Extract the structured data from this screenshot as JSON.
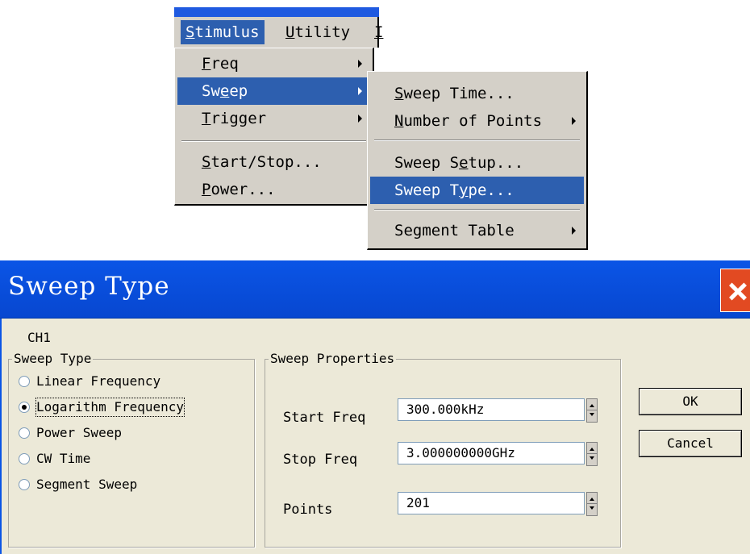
{
  "menubar": {
    "items": [
      {
        "label": "Stimulus",
        "mnemonic_first": "S",
        "rest": "timulus",
        "selected": true
      },
      {
        "label": "Utility",
        "mnemonic_first": "U",
        "rest": "tility",
        "selected": false
      },
      {
        "label": "I",
        "mnemonic_first": "I",
        "rest": "",
        "selected": false
      }
    ]
  },
  "stimulus_menu": {
    "items": [
      {
        "pre": "",
        "mn": "F",
        "post": "req",
        "submenu": true
      },
      {
        "pre": "Sw",
        "mn": "e",
        "post": "ep",
        "submenu": true,
        "selected": true
      },
      {
        "pre": "",
        "mn": "T",
        "post": "rigger",
        "submenu": true
      },
      {
        "pre": "",
        "mn": "S",
        "post": "tart/Stop...",
        "submenu": false
      },
      {
        "pre": "",
        "mn": "P",
        "post": "ower...",
        "submenu": false
      }
    ]
  },
  "sweep_menu": {
    "items": [
      {
        "pre": "",
        "mn": "S",
        "post": "weep Time...",
        "submenu": false
      },
      {
        "pre": "",
        "mn": "N",
        "post": "umber of Points",
        "submenu": true
      },
      {
        "pre": "Sweep S",
        "mn": "e",
        "post": "tup...",
        "submenu": false
      },
      {
        "pre": "Sweep T",
        "mn": "y",
        "post": "pe...",
        "submenu": false,
        "selected": true
      },
      {
        "pre": "Segment Table",
        "mn": "",
        "post": "",
        "submenu": true
      }
    ]
  },
  "dialog": {
    "title": "Sweep Type",
    "channel": "CH1",
    "sweep_type_group": {
      "label": "Sweep Type",
      "options": [
        {
          "label": "Linear Frequency",
          "checked": false
        },
        {
          "label": "Logarithm Frequency",
          "checked": true
        },
        {
          "label": "Power Sweep",
          "checked": false
        },
        {
          "label": "CW Time",
          "checked": false
        },
        {
          "label": "Segment Sweep",
          "checked": false
        }
      ]
    },
    "properties_group": {
      "label": "Sweep Properties",
      "start_freq_label": "Start Freq",
      "start_freq_value": "300.000kHz",
      "stop_freq_label": "Stop Freq",
      "stop_freq_value": "3.000000000GHz",
      "points_label": "Points",
      "points_value": "201"
    },
    "ok_label": "OK",
    "cancel_label": "Cancel"
  },
  "colors": {
    "title_bar": "#0b55e6",
    "menu_highlight": "#2d5faf",
    "close_button": "#e24a22",
    "dialog_bg": "#ece9d8",
    "menu_bg": "#d4d0c8"
  }
}
